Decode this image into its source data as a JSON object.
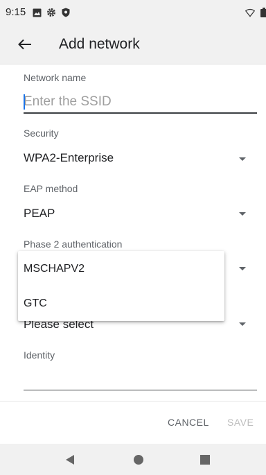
{
  "status_bar": {
    "time": "9:15",
    "icons": [
      "image-icon",
      "gear-icon",
      "shield-icon",
      "wifi-icon",
      "battery-icon"
    ]
  },
  "app_bar": {
    "back_icon": "arrow-left-icon",
    "title": "Add network"
  },
  "form": {
    "network_name": {
      "label": "Network name",
      "value": "",
      "placeholder": "Enter the SSID"
    },
    "security": {
      "label": "Security",
      "value": "WPA2-Enterprise"
    },
    "eap_method": {
      "label": "EAP method",
      "value": "PEAP"
    },
    "phase2": {
      "label": "Phase 2 authentication",
      "options": [
        "MSCHAPV2",
        "GTC"
      ]
    },
    "ca_certificate": {
      "value": "Please select"
    },
    "identity": {
      "label": "Identity",
      "value": ""
    }
  },
  "actions": {
    "cancel_label": "CANCEL",
    "save_label": "SAVE"
  },
  "colors": {
    "accent": "#1a73e8",
    "bar_background": "#f1f1f1",
    "disabled_text": "#bdbdbd"
  },
  "nav_bar": {
    "icons": [
      "back-triangle-icon",
      "home-circle-icon",
      "recents-square-icon"
    ]
  }
}
